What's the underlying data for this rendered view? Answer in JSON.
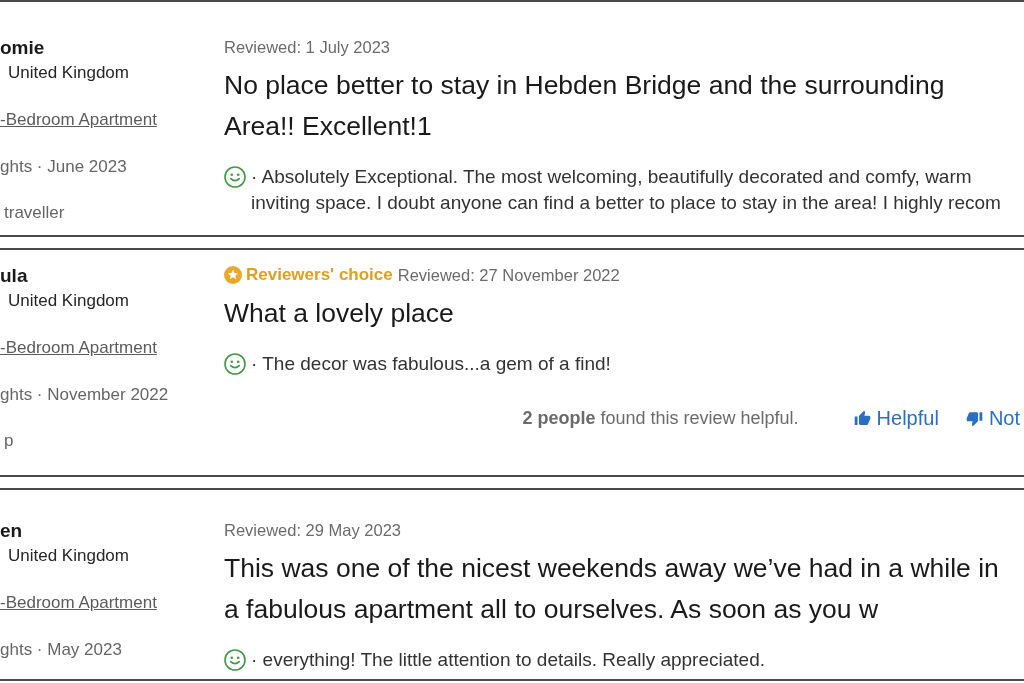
{
  "reviews": [
    {
      "guest": {
        "name": "omie",
        "country": "United Kingdom",
        "room": "-Bedroom Apartment",
        "stay": "ghts · June 2023",
        "traveller_type": "traveller"
      },
      "reviewed": "Reviewed: 1 July 2023",
      "title": "No place better to stay in Hebden Bridge and the surrounding Area!! Excellent!1",
      "body": "· Absolutely Exceptional. The most welcoming, beautifully decorated and comfy, warm inviting space. I doubt anyone can find a better to place to stay in the area! I highly recom"
    },
    {
      "guest": {
        "name": "ula",
        "country": "United Kingdom",
        "room": "-Bedroom Apartment",
        "stay": "ghts · November 2022",
        "traveller_type": "p"
      },
      "badge": "Reviewers' choice",
      "reviewed": "Reviewed: 27 November 2022",
      "title": "What a lovely place",
      "body": "· The decor was fabulous...a gem of a find!",
      "helpful_note": "**2 people** found this review helpful.",
      "votes": [
        {
          "kind": "up",
          "label": "Helpful"
        },
        {
          "kind": "down",
          "label": "Not"
        }
      ]
    },
    {
      "guest": {
        "name": "en",
        "country": "United Kingdom",
        "room": "-Bedroom Apartment",
        "stay": "ghts · May 2023"
      },
      "reviewed": "Reviewed: 29 May 2023",
      "title": "This was one of the nicest weekends away we’ve had in a while in a fabulous apartment all to ourselves. As soon as you w",
      "body": "· everything! The little attention to details. Really appreciated."
    }
  ]
}
